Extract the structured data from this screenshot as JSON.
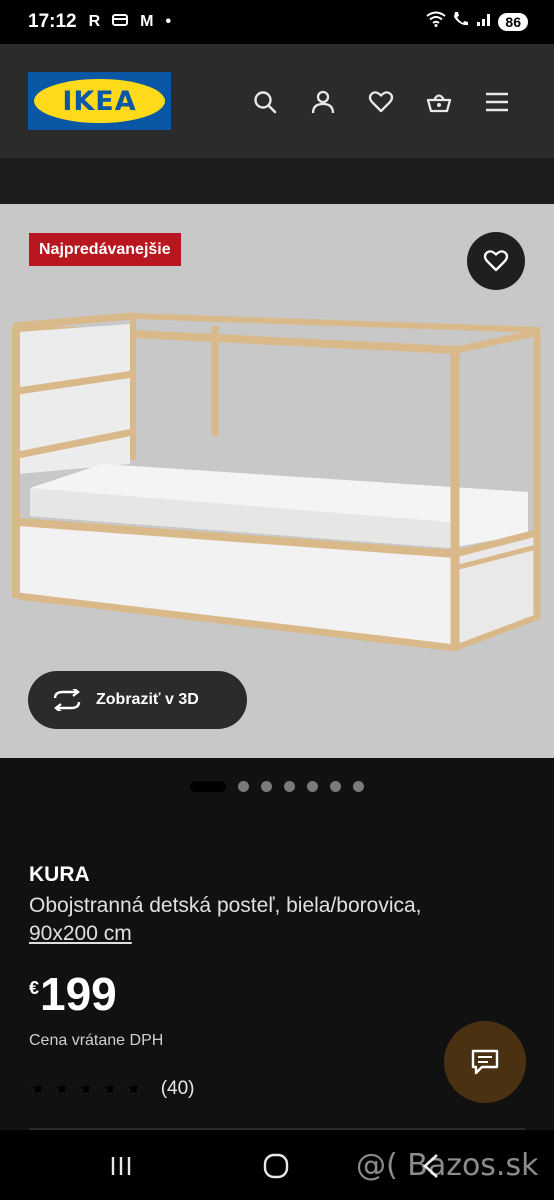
{
  "status_bar": {
    "time": "17:12",
    "icons_left": [
      "R",
      "wallet-icon",
      "M",
      "•"
    ],
    "battery": "86"
  },
  "header": {
    "logo_text": "IKEA",
    "icons": [
      "search-icon",
      "user-icon",
      "heart-icon",
      "basket-icon",
      "menu-icon"
    ]
  },
  "gallery": {
    "badge": "Najpredávanejšie",
    "view3d_label": "Zobraziť v 3D",
    "slide_count": 7,
    "active_slide": 1
  },
  "product": {
    "name": "KURA",
    "description": "Obojstranná detská posteľ, biela/borovica,",
    "size": "90x200 cm",
    "currency": "€",
    "price": "199",
    "price_note": "Cena vrátane DPH",
    "rating_stars": 5,
    "rating_count": "(40)"
  },
  "nav_bar": {
    "recents": "|||",
    "home": "◯",
    "back": "‹"
  },
  "watermark": "@( Bazos.sk",
  "colors": {
    "badge": "#b8171f",
    "ikea_blue": "#0a57a6",
    "ikea_yellow": "#ffda1a",
    "chat": "#4a3112"
  }
}
